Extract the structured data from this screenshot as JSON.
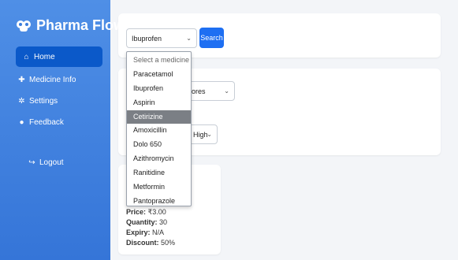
{
  "app": {
    "brand": "Pharma Flow"
  },
  "sidebar": {
    "items": [
      {
        "label": "Home",
        "icon": "home-icon"
      },
      {
        "label": "Medicine Info",
        "icon": "medicine-icon"
      },
      {
        "label": "Settings",
        "icon": "gear-icon"
      },
      {
        "label": "Feedback",
        "icon": "chat-icon"
      }
    ],
    "logout": "Logout"
  },
  "search": {
    "selected": "Ibuprofen",
    "button": "Search",
    "dropdown": {
      "placeholder": "Select a medicine",
      "options": [
        "Paracetamol",
        "Ibuprofen",
        "Aspirin",
        "Cetirizine",
        "Amoxicillin",
        "Dolo 650",
        "Azithromycin",
        "Ranitidine",
        "Metformin",
        "Pantoprazole"
      ],
      "highlighted": "Cetirizine"
    }
  },
  "filters": {
    "sort_partial": "ores",
    "order_partial": "High"
  },
  "result": {
    "price_label": "Price:",
    "price": "₹3.00",
    "quantity_label": "Quantity:",
    "quantity": "30",
    "expiry_label": "Expiry:",
    "expiry": "N/A",
    "discount_label": "Discount:",
    "discount": "50%"
  },
  "colors": {
    "sidebar": "#3b7ddc",
    "active": "#0b59c9",
    "button": "#1e6ff2",
    "highlight": "#7b7f85"
  }
}
